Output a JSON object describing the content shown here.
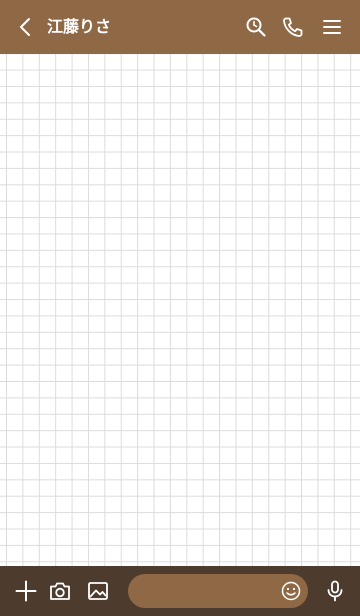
{
  "header": {
    "title": "江藤りさ",
    "icons": [
      "back-icon",
      "search-icon",
      "phone-icon",
      "menu-icon"
    ],
    "background_color": "#8f6946"
  },
  "chat": {
    "background": "grid-paper",
    "grid_line_color": "#dcdcdc"
  },
  "footer": {
    "background_color": "#4d3c2e",
    "icons": [
      "plus-icon",
      "camera-icon",
      "image-icon",
      "emoji-icon",
      "mic-icon"
    ],
    "message_input": {
      "value": "",
      "placeholder": ""
    }
  }
}
